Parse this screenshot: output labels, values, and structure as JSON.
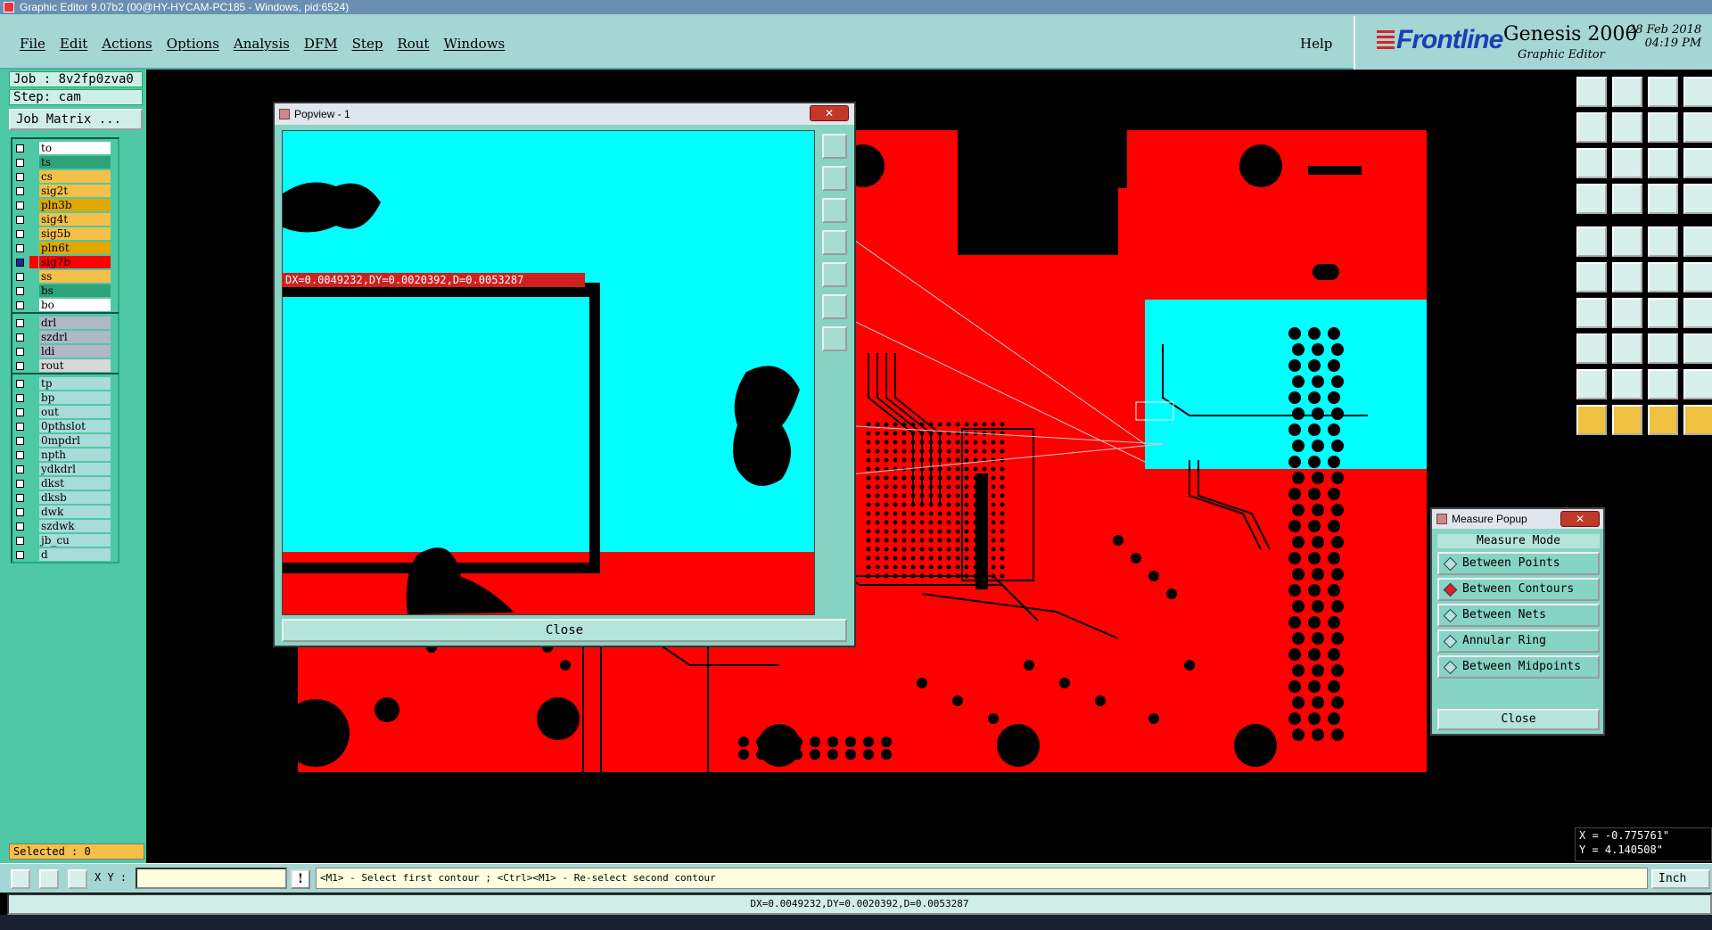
{
  "window": {
    "title": "Graphic Editor 9.07b2 (00@HY-HYCAM-PC185 - Windows, pid:6524)"
  },
  "menu": {
    "items": [
      "File",
      "Edit",
      "Actions",
      "Options",
      "Analysis",
      "DFM",
      "Step",
      "Rout",
      "Windows"
    ],
    "help": "Help"
  },
  "brand": {
    "logo": "Frontline",
    "product": "Genesis 2000",
    "subtitle": "Graphic Editor",
    "date": "28 Feb 2018",
    "time": "04:19 PM"
  },
  "job": {
    "job_label": "Job : 8v2fp0zva0",
    "step_label": "Step: cam",
    "matrix_button": "Job Matrix ..."
  },
  "layers_group1": [
    {
      "name": "to",
      "color": "#ffffff"
    },
    {
      "name": "ts",
      "color": "#2ea37a"
    },
    {
      "name": "cs",
      "color": "#f5c04a"
    },
    {
      "name": "sig2t",
      "color": "#f5c04a"
    },
    {
      "name": "pln3b",
      "color": "#e0a800"
    },
    {
      "name": "sig4t",
      "color": "#f5c04a"
    },
    {
      "name": "sig5b",
      "color": "#f5c04a"
    },
    {
      "name": "pln6t",
      "color": "#e0a800"
    },
    {
      "name": "sig7b",
      "color": "#ff0000",
      "active": true
    },
    {
      "name": "ss",
      "color": "#f5c04a"
    },
    {
      "name": "bs",
      "color": "#2ea37a"
    },
    {
      "name": "bo",
      "color": "#ffffff"
    }
  ],
  "layers_group2": [
    {
      "name": "drl",
      "color": "#b0b8c4"
    },
    {
      "name": "szdrl",
      "color": "#b0b8c4"
    },
    {
      "name": "ldi",
      "color": "#b0b8c4"
    },
    {
      "name": "rout",
      "color": "#d8d8d8"
    }
  ],
  "layers_group3": [
    {
      "name": "tp",
      "color": "#a8dcd8"
    },
    {
      "name": "bp",
      "color": "#a8dcd8"
    },
    {
      "name": "out",
      "color": "#a8dcd8"
    },
    {
      "name": "0pthslot",
      "color": "#a8dcd8"
    },
    {
      "name": "0mpdrl",
      "color": "#a8dcd8"
    },
    {
      "name": "npth",
      "color": "#a8dcd8"
    },
    {
      "name": "ydkdrl",
      "color": "#a8dcd8"
    },
    {
      "name": "dkst",
      "color": "#a8dcd8"
    },
    {
      "name": "dksb",
      "color": "#a8dcd8"
    },
    {
      "name": "dwk",
      "color": "#a8dcd8"
    },
    {
      "name": "szdwk",
      "color": "#a8dcd8"
    },
    {
      "name": "jb_cu",
      "color": "#a8dcd8"
    },
    {
      "name": "d",
      "color": "#a8dcd8"
    }
  ],
  "selected": "Selected : 0",
  "popview": {
    "title": "Popview - 1",
    "readout": "DX=0.0049232,DY=0.0020392,D=0.0053287",
    "close": "Close"
  },
  "measure": {
    "title": "Measure Popup",
    "mode_header": "Measure Mode",
    "options": [
      {
        "label": "Between Points",
        "on": false
      },
      {
        "label": "Between Contours",
        "on": true
      },
      {
        "label": "Between Nets",
        "on": false
      },
      {
        "label": "Annular Ring",
        "on": false
      },
      {
        "label": "Between Midpoints",
        "on": false
      }
    ],
    "close": "Close"
  },
  "coords": {
    "x": "X = -0.775761\"",
    "y": "Y = 4.140508\""
  },
  "cmd": {
    "xy_label": "X Y :",
    "xy_value": "",
    "prompt": "<M1> - Select first contour ; <Ctrl><M1> - Re-select second contour",
    "units": "Inch",
    "bang": "!"
  },
  "status": "DX=0.0049232,DY=0.0020392,D=0.0053287",
  "icons": {
    "close": "close-icon",
    "popview_tools": [
      "zoom-fit-icon",
      "zoom-in-icon",
      "zoom-out-icon",
      "pan-left-icon",
      "pan-right-icon",
      "zoom-extents-icon",
      "zoom-center-icon"
    ]
  },
  "colors": {
    "copper": "#ff0000",
    "cyan_area": "#00ffff",
    "panel_bg": "#4fc8a5",
    "menu_bg": "#a4d6d3"
  }
}
